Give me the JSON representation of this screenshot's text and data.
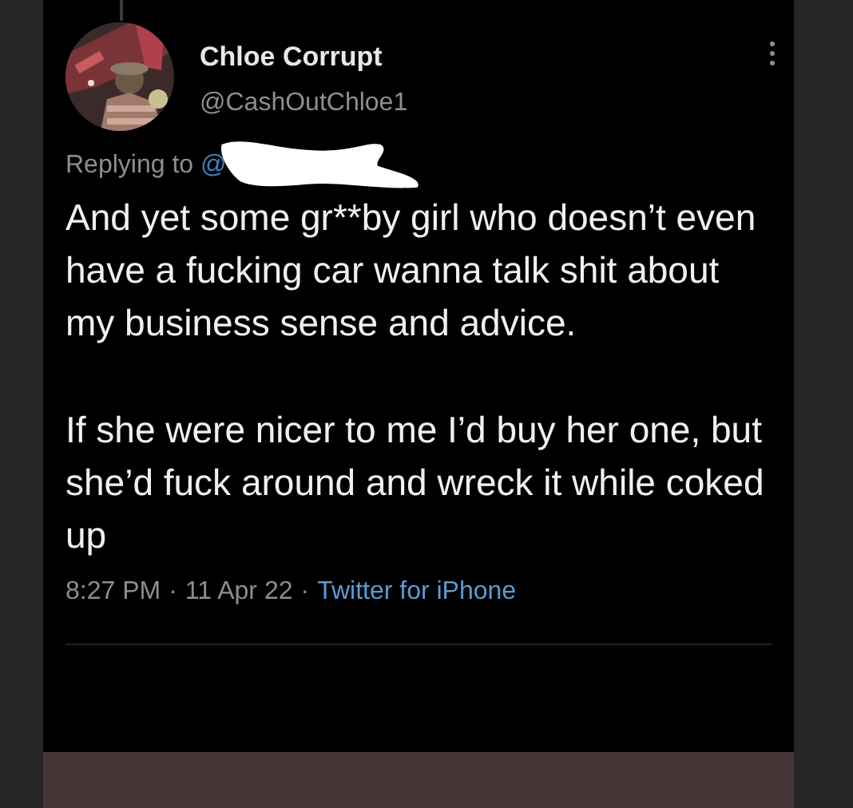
{
  "tweet": {
    "author": {
      "name": "Chloe Corrupt",
      "handle": "@CashOutChloe1"
    },
    "reply_to": {
      "label": "Replying to",
      "handle": "@"
    },
    "paragraphs": [
      "And yet some gr**by girl who doesn’t even have a fucking car wanna talk shit about my business sense and advice.",
      "If she were nicer to me I’d buy her one, but she’d fuck around and wreck it while coked up"
    ],
    "meta": {
      "time": "8:27 PM",
      "separator_1": "·",
      "date": "11 Apr 22",
      "separator_2": "·",
      "source": "Twitter for iPhone"
    }
  }
}
